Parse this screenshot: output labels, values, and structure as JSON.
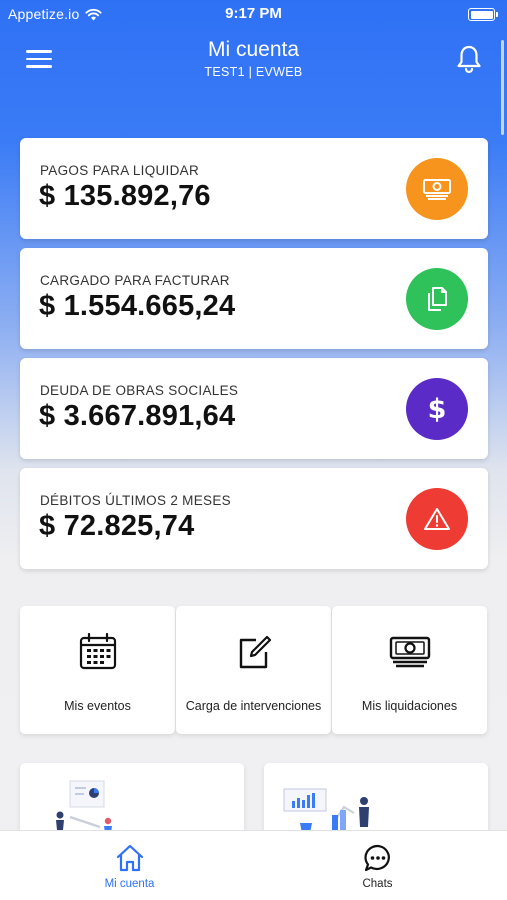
{
  "status_bar": {
    "carrier": "Appetize.io",
    "time": "9:17 PM"
  },
  "header": {
    "title": "Mi cuenta",
    "subtitle": "TEST1 | EVWEB"
  },
  "cards": [
    {
      "label": "PAGOS PARA LIQUIDAR",
      "value": "$ 135.892,76",
      "icon": "cash-icon",
      "color": "#f7941d"
    },
    {
      "label": "CARGADO PARA FACTURAR",
      "value": "$ 1.554.665,24",
      "icon": "documents-icon",
      "color": "#2fc15a"
    },
    {
      "label": "DEUDA DE OBRAS SOCIALES",
      "value": "$ 3.667.891,64",
      "icon": "dollar-icon",
      "color": "#5b2bc8"
    },
    {
      "label": "DÉBITOS ÚLTIMOS 2 MESES",
      "value": "$ 72.825,74",
      "icon": "warning-icon",
      "color": "#ee3b33"
    }
  ],
  "shortcuts": [
    {
      "label": "Mis eventos",
      "icon": "calendar-icon"
    },
    {
      "label": "Carga de intervenciones",
      "icon": "edit-icon"
    },
    {
      "label": "Mis liquidaciones",
      "icon": "cash-icon"
    }
  ],
  "tabs": [
    {
      "label": "Mi cuenta",
      "icon": "home-icon",
      "active": true
    },
    {
      "label": "Chats",
      "icon": "chat-icon",
      "active": false
    }
  ],
  "colors": {
    "accent": "#2f71f5",
    "tab_active": "#2f71f5",
    "tab_inactive": "#222222"
  }
}
